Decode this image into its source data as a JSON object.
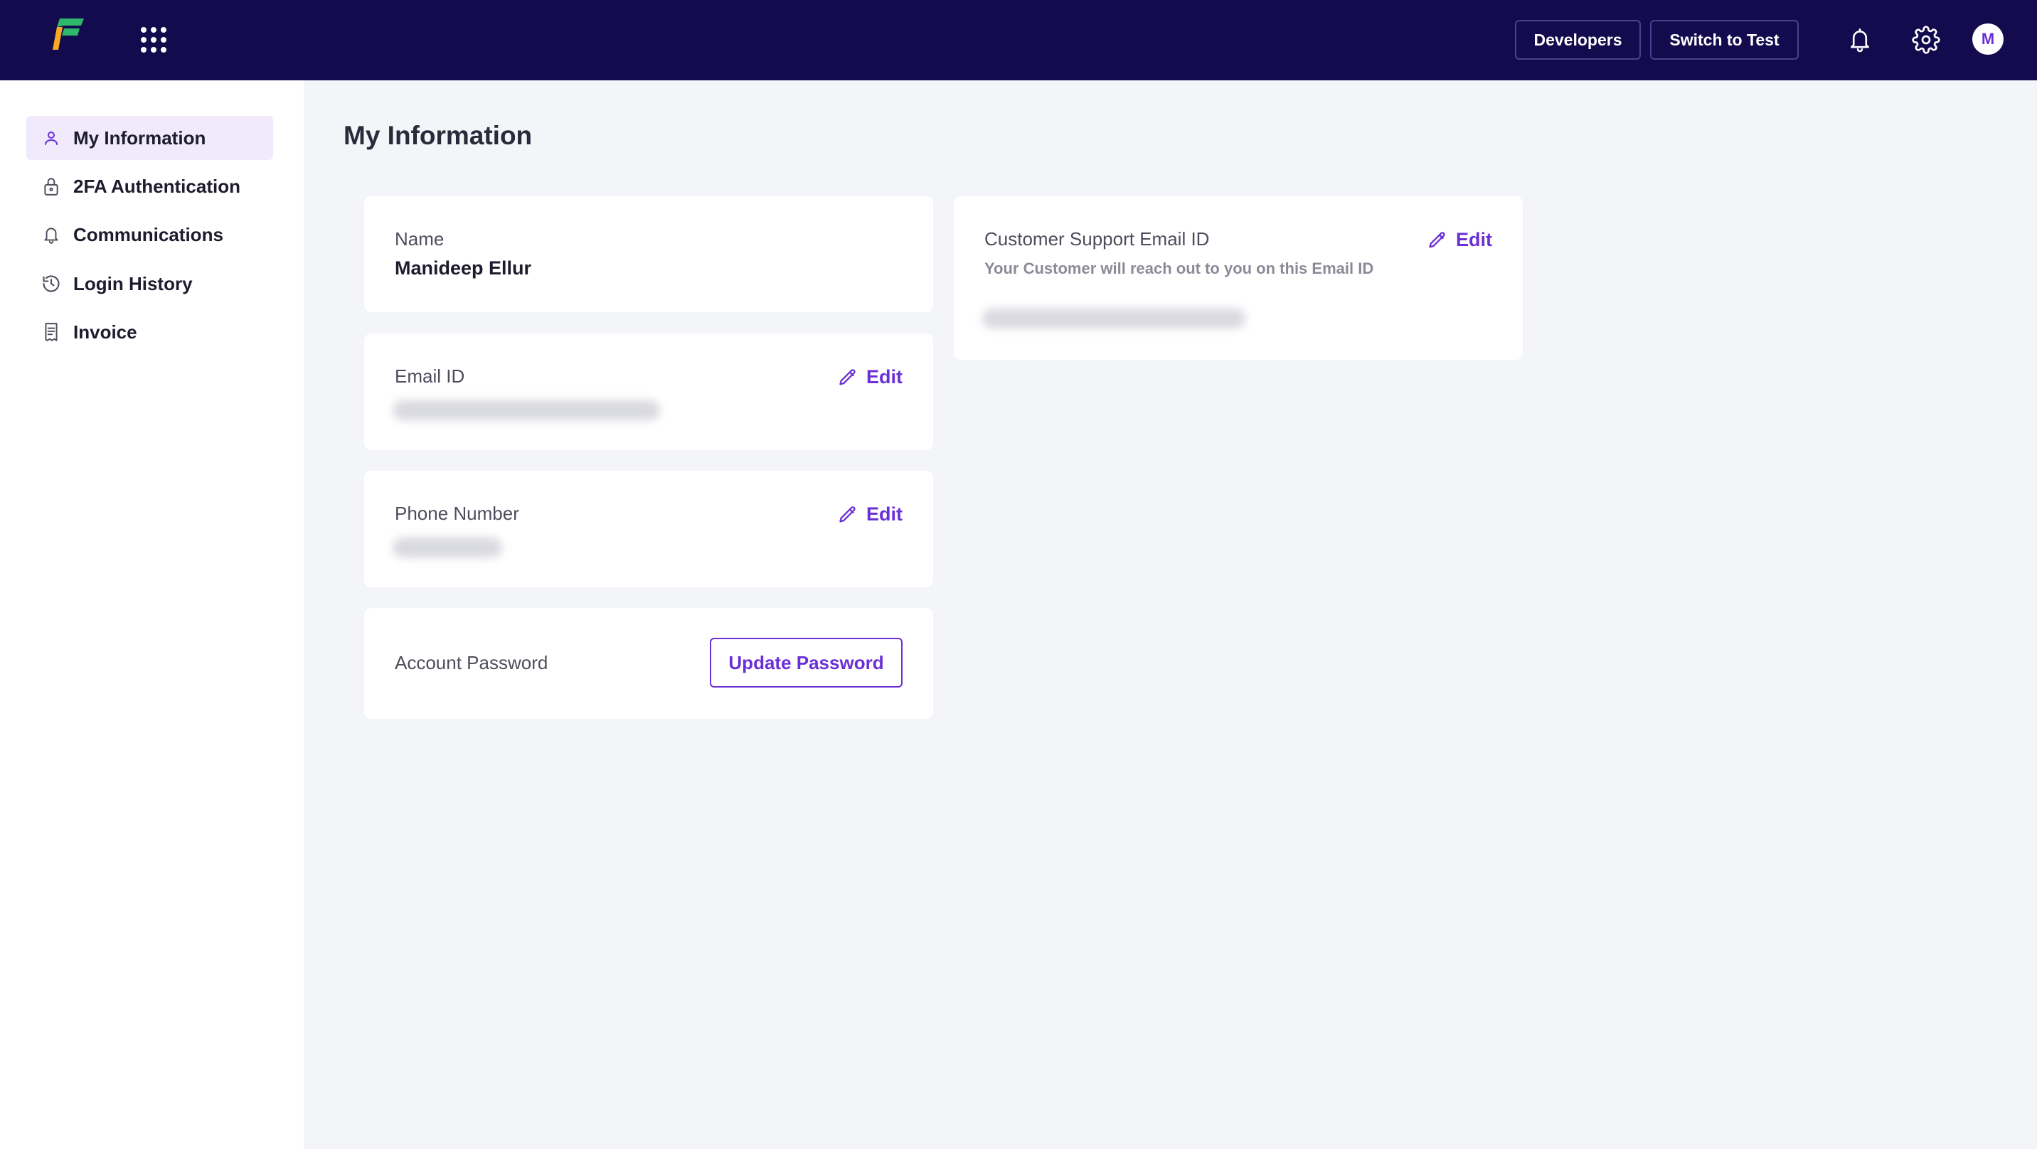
{
  "topbar": {
    "developers_label": "Developers",
    "switch_label": "Switch to Test",
    "avatar_initial": "M"
  },
  "sidebar": {
    "items": [
      {
        "label": "My Information",
        "icon": "user-icon"
      },
      {
        "label": "2FA Authentication",
        "icon": "lock-icon"
      },
      {
        "label": "Communications",
        "icon": "bell-icon"
      },
      {
        "label": "Login History",
        "icon": "history-icon"
      },
      {
        "label": "Invoice",
        "icon": "invoice-icon"
      }
    ]
  },
  "main": {
    "title": "My Information",
    "name_card": {
      "label": "Name",
      "value": "Manideep Ellur"
    },
    "email_card": {
      "label": "Email ID",
      "edit_label": "Edit"
    },
    "phone_card": {
      "label": "Phone Number",
      "edit_label": "Edit"
    },
    "password_card": {
      "label": "Account Password",
      "button_label": "Update Password"
    },
    "support_card": {
      "label": "Customer Support Email ID",
      "subtitle": "Your Customer will reach out to you on this Email ID",
      "edit_label": "Edit"
    }
  },
  "colors": {
    "topbar_bg": "#130b4d",
    "accent": "#6b2fd6",
    "active_item_bg": "#f0eafc",
    "page_bg": "#f4f5f9"
  }
}
